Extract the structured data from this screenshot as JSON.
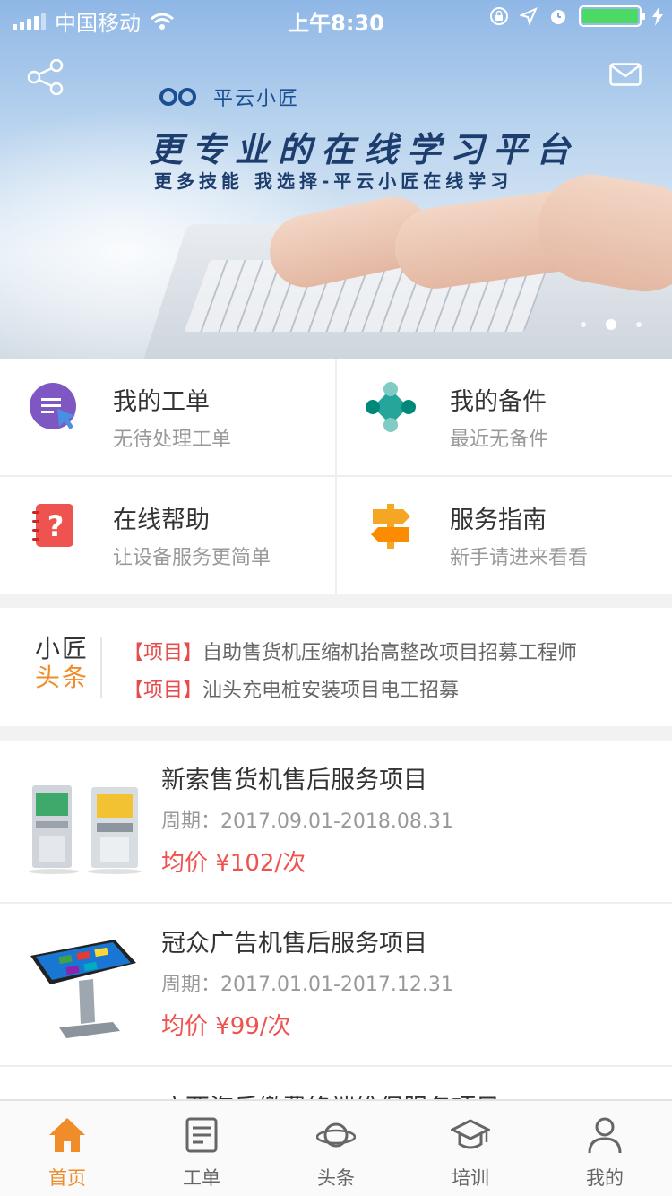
{
  "status_bar": {
    "carrier": "中国移动",
    "time": "上午8:30",
    "battery_color": "#4cd964"
  },
  "banner": {
    "logo_text": "平云小匠",
    "slogan": "更专业的在线学习平台",
    "subslogan": "更多技能 我选择-平云小匠在线学习",
    "share_icon": "share-icon",
    "mail_icon": "mail-icon"
  },
  "quick_links": [
    {
      "title": "我的工单",
      "subtitle": "无待处理工单",
      "icon": "work-order-icon",
      "color": "#7e57c2"
    },
    {
      "title": "我的备件",
      "subtitle": "最近无备件",
      "icon": "spare-parts-icon",
      "color": "#26a69a"
    },
    {
      "title": "在线帮助",
      "subtitle": "让设备服务更简单",
      "icon": "help-notebook-icon",
      "color": "#ef5350"
    },
    {
      "title": "服务指南",
      "subtitle": "新手请进来看看",
      "icon": "signpost-icon",
      "color": "#f5a623"
    }
  ],
  "headlines": {
    "brand_line1": "小匠",
    "brand_line2": "头条",
    "items": [
      {
        "tag": "【项目】",
        "text": "自助售货机压缩机抬高整改项目招募工程师"
      },
      {
        "tag": "【项目】",
        "text": "汕头充电桩安装项目电工招募"
      }
    ]
  },
  "projects": [
    {
      "name": "新索售货机售后服务项目",
      "period": "周期：2017.09.01-2018.08.31",
      "price": "均价 ¥102/次",
      "image": "vending-machine-image"
    },
    {
      "name": "冠众广告机售后服务项目",
      "period": "周期：2017.01.01-2017.12.31",
      "price": "均价 ¥99/次",
      "image": "ad-kiosk-image"
    },
    {
      "name": "广西海乐缴费终端维保服务项目",
      "period": "",
      "price": "",
      "image": ""
    }
  ],
  "tabbar": {
    "active_color": "#f08c2a",
    "tabs": [
      {
        "label": "首页",
        "icon": "home-icon"
      },
      {
        "label": "工单",
        "icon": "document-icon"
      },
      {
        "label": "头条",
        "icon": "planet-icon"
      },
      {
        "label": "培训",
        "icon": "graduation-cap-icon"
      },
      {
        "label": "我的",
        "icon": "person-icon"
      }
    ]
  }
}
